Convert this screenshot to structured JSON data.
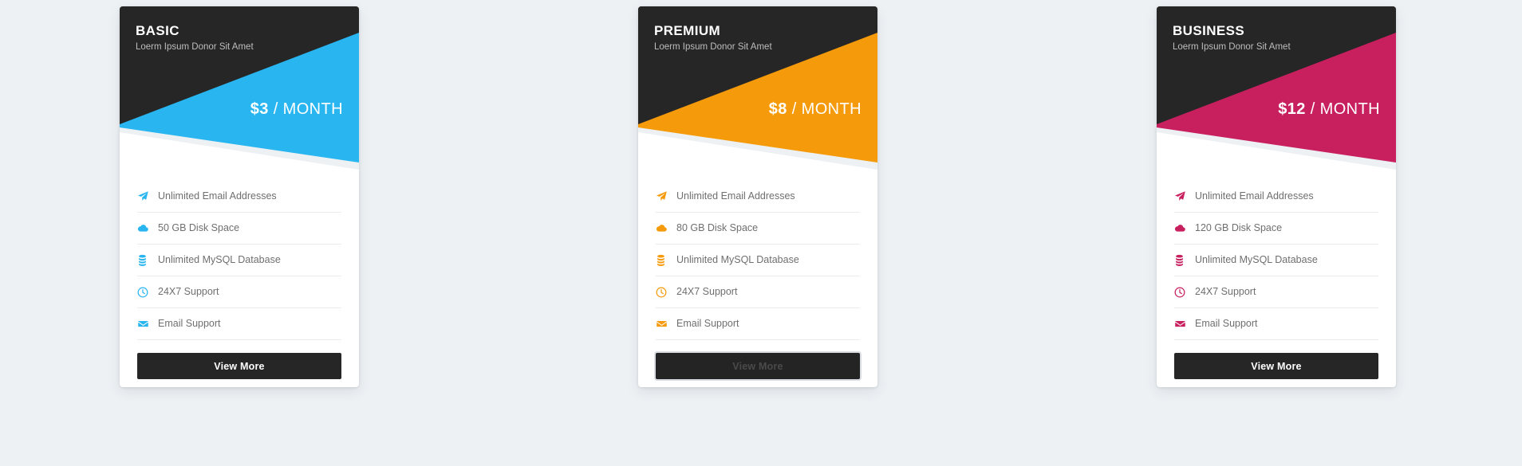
{
  "page": {
    "background_color": "#edf1f4"
  },
  "plans": [
    {
      "id": "basic",
      "name": "BASIC",
      "subtitle": "Loerm Ipsum Donor Sit Amet",
      "price_amount": "$3",
      "price_period": " / MONTH",
      "accent_color": "#29b6f0",
      "header_color": "#262626",
      "button_label": "View More",
      "button_state": "normal",
      "features": [
        {
          "icon": "paper-plane-icon",
          "label": "Unlimited Email Addresses"
        },
        {
          "icon": "cloud-icon",
          "label": "50 GB Disk Space"
        },
        {
          "icon": "database-icon",
          "label": "Unlimited MySQL Database"
        },
        {
          "icon": "clock-icon",
          "label": "24X7 Support"
        },
        {
          "icon": "envelope-icon",
          "label": "Email Support"
        }
      ]
    },
    {
      "id": "premium",
      "name": "PREMIUM",
      "subtitle": "Loerm Ipsum Donor Sit Amet",
      "price_amount": "$8",
      "price_period": " / MONTH",
      "accent_color": "#f59b0b",
      "header_color": "#262626",
      "button_label": "View More",
      "button_state": "pressed",
      "features": [
        {
          "icon": "paper-plane-icon",
          "label": "Unlimited Email Addresses"
        },
        {
          "icon": "cloud-icon",
          "label": "80 GB Disk Space"
        },
        {
          "icon": "database-icon",
          "label": "Unlimited MySQL Database"
        },
        {
          "icon": "clock-icon",
          "label": "24X7 Support"
        },
        {
          "icon": "envelope-icon",
          "label": "Email Support"
        }
      ]
    },
    {
      "id": "business",
      "name": "BUSINESS",
      "subtitle": "Loerm Ipsum Donor Sit Amet",
      "price_amount": "$12",
      "price_period": " / MONTH",
      "accent_color": "#c8205f",
      "header_color": "#262626",
      "button_label": "View More",
      "button_state": "normal",
      "features": [
        {
          "icon": "paper-plane-icon",
          "label": "Unlimited Email Addresses"
        },
        {
          "icon": "cloud-icon",
          "label": "120 GB Disk Space"
        },
        {
          "icon": "database-icon",
          "label": "Unlimited MySQL Database"
        },
        {
          "icon": "clock-icon",
          "label": "24X7 Support"
        },
        {
          "icon": "envelope-icon",
          "label": "Email Support"
        }
      ]
    }
  ]
}
